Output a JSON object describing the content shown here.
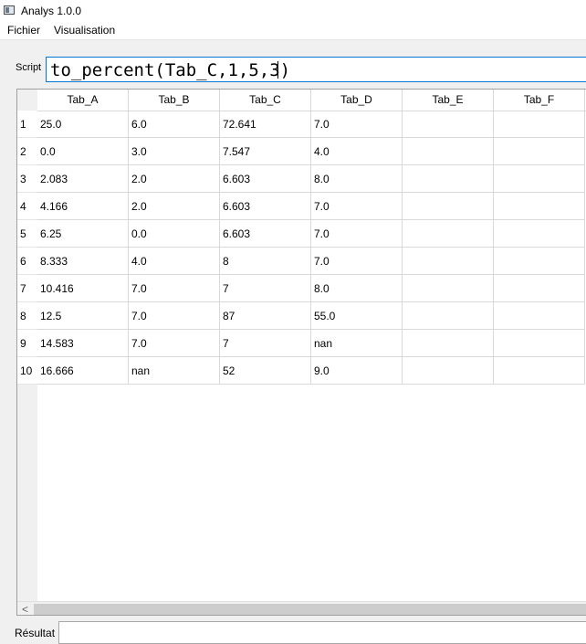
{
  "window": {
    "title": "Analys 1.0.0"
  },
  "menu": {
    "items": [
      "Fichier",
      "Visualisation"
    ]
  },
  "script": {
    "label": "Script",
    "value": "to_percent(Tab_C,1,5,3)"
  },
  "table": {
    "columns": [
      "Tab_A",
      "Tab_B",
      "Tab_C",
      "Tab_D",
      "Tab_E",
      "Tab_F"
    ],
    "rows": [
      {
        "num": "1",
        "cells": [
          "25.0",
          "6.0",
          "72.641",
          "7.0",
          "",
          ""
        ]
      },
      {
        "num": "2",
        "cells": [
          "0.0",
          "3.0",
          "7.547",
          "4.0",
          "",
          ""
        ]
      },
      {
        "num": "3",
        "cells": [
          "2.083",
          "2.0",
          "6.603",
          "8.0",
          "",
          ""
        ]
      },
      {
        "num": "4",
        "cells": [
          "4.166",
          "2.0",
          "6.603",
          "7.0",
          "",
          ""
        ]
      },
      {
        "num": "5",
        "cells": [
          "6.25",
          "0.0",
          "6.603",
          "7.0",
          "",
          ""
        ]
      },
      {
        "num": "6",
        "cells": [
          "8.333",
          "4.0",
          "8",
          "7.0",
          "",
          ""
        ]
      },
      {
        "num": "7",
        "cells": [
          "10.416",
          "7.0",
          "7",
          "8.0",
          "",
          ""
        ]
      },
      {
        "num": "8",
        "cells": [
          "12.5",
          "7.0",
          "87",
          "55.0",
          "",
          ""
        ]
      },
      {
        "num": "9",
        "cells": [
          "14.583",
          "7.0",
          "7",
          "nan",
          "",
          ""
        ]
      },
      {
        "num": "10",
        "cells": [
          "16.666",
          "nan",
          "52",
          "9.0",
          "",
          ""
        ]
      }
    ]
  },
  "scrollbar": {
    "left_arrow": "<"
  },
  "result": {
    "label": "Résultat",
    "value": ""
  }
}
